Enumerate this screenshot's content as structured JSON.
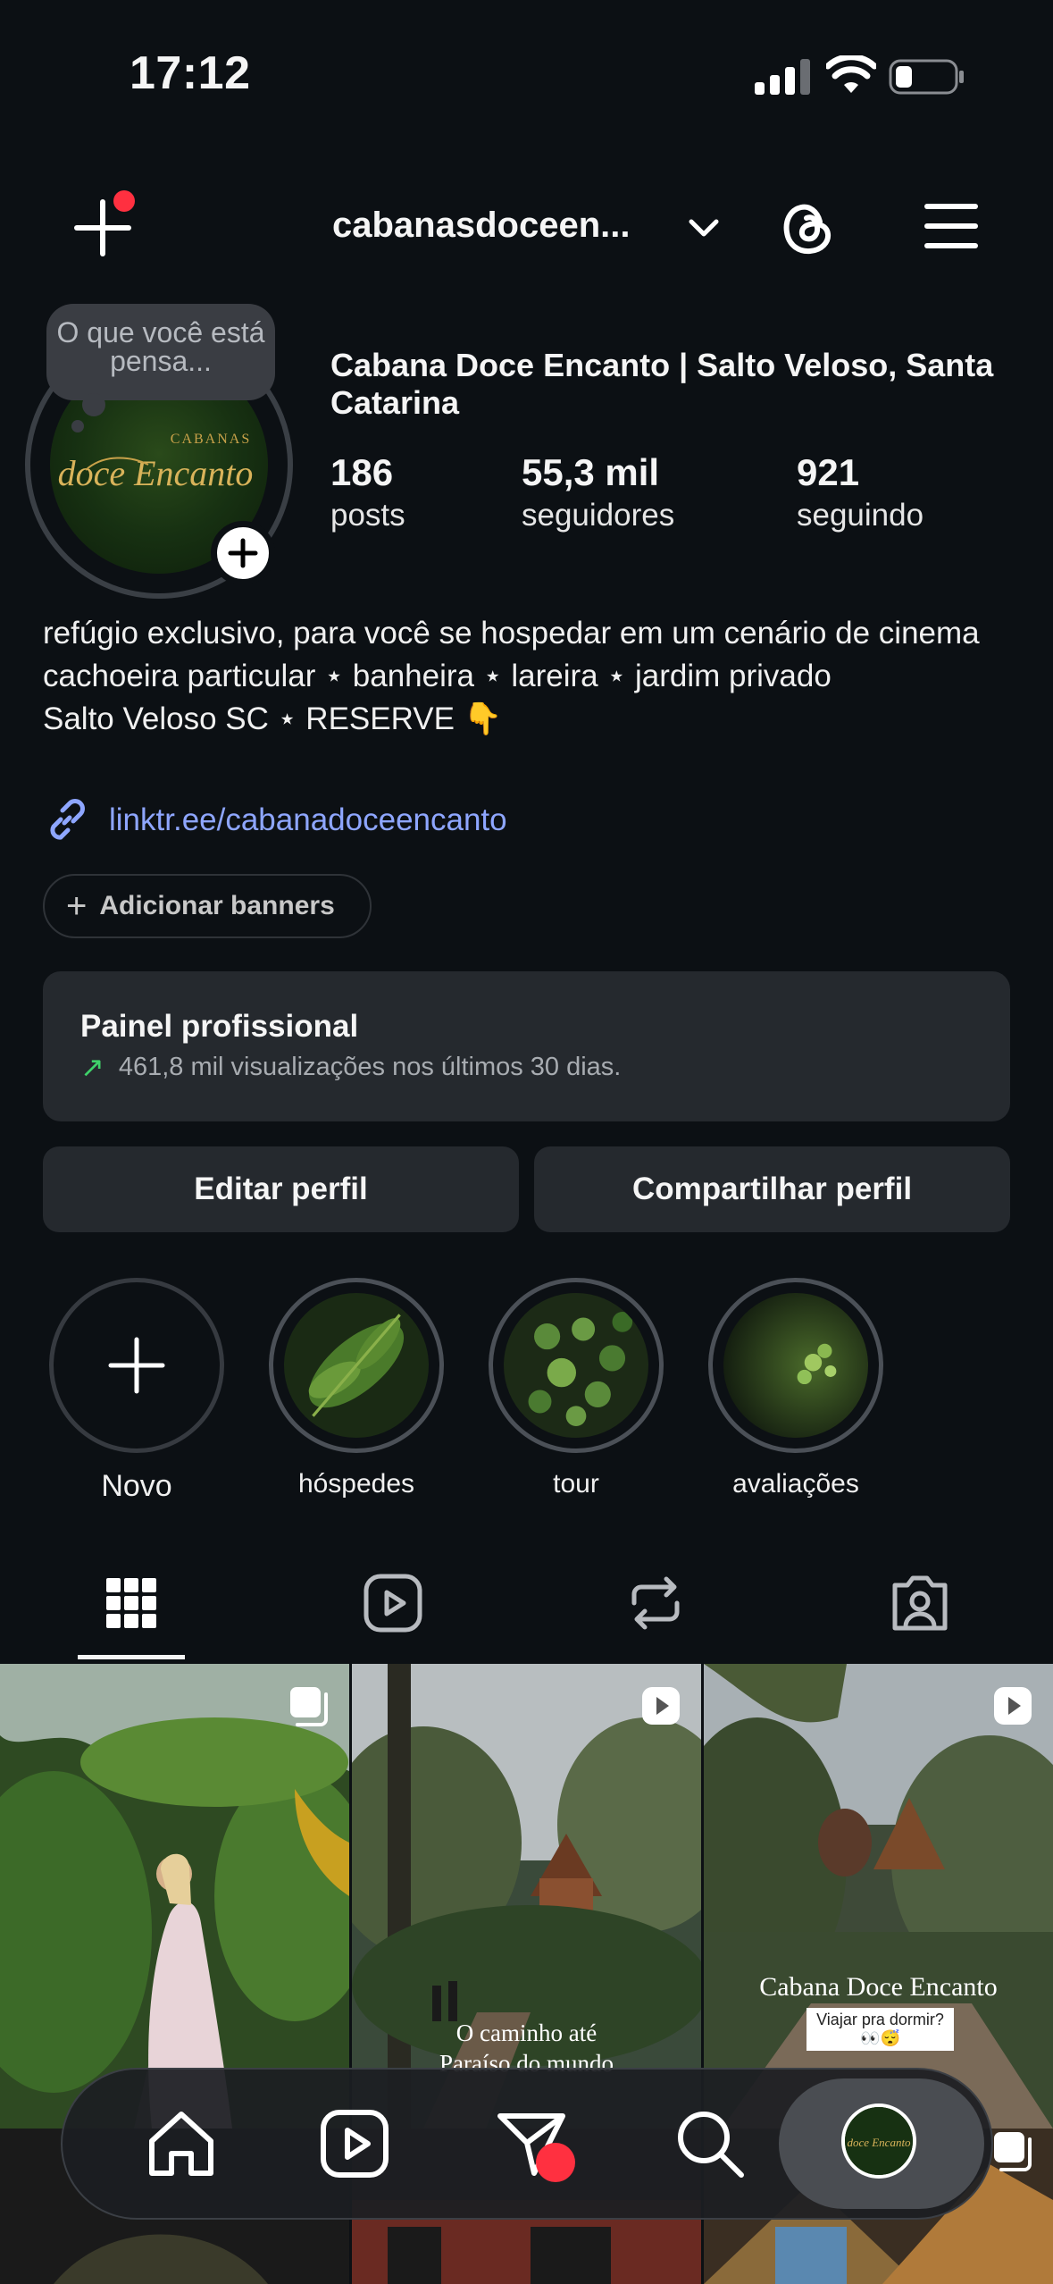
{
  "status_bar": {
    "time": "17:12"
  },
  "header": {
    "username": "cabanasdoceen..."
  },
  "profile": {
    "note": "O que você está pensa...",
    "name": "Cabana Doce Encanto | Salto Veloso, Santa Catarina",
    "logo_top": "CABANAS",
    "logo_main": "doce Encanto",
    "stats": [
      {
        "value": "186",
        "label": "posts"
      },
      {
        "value": "55,3 mil",
        "label": "seguidores"
      },
      {
        "value": "921",
        "label": "seguindo"
      }
    ],
    "bio_lines": [
      "refúgio exclusivo, para você se hospedar em um cenário de cinema",
      "cachoeira particular ⋆ banheira ⋆ lareira ⋆ jardim privado",
      "Salto Veloso SC ⋆ RESERVE 👇"
    ],
    "link": "linktr.ee/cabanadoceencanto"
  },
  "banners_button": "Adicionar banners",
  "dashboard": {
    "title": "Painel profissional",
    "subtitle": "461,8 mil visualizações nos últimos 30 dias."
  },
  "actions": {
    "edit": "Editar perfil",
    "share": "Compartilhar perfil"
  },
  "highlights": [
    {
      "label": "Novo"
    },
    {
      "label": "hóspedes"
    },
    {
      "label": "tour"
    },
    {
      "label": "avaliações"
    }
  ],
  "tabs": [
    "grid-icon",
    "reels-icon",
    "reposts-icon",
    "tagged-icon"
  ],
  "grid": [
    {
      "type": "carousel",
      "caption": ""
    },
    {
      "type": "reel",
      "caption_line1": "O caminho até",
      "caption_line2": "Paraíso do mundo"
    },
    {
      "type": "reel",
      "caption_line1": "Cabana Doce Encanto",
      "caption_line2": "Viajar pra dormir? 👀😴"
    }
  ],
  "colors": {
    "background": "#0c1014",
    "card": "#25292e",
    "link": "#8ea6ff",
    "accent_red": "#ff3040",
    "trend_green": "#3fd26a"
  }
}
